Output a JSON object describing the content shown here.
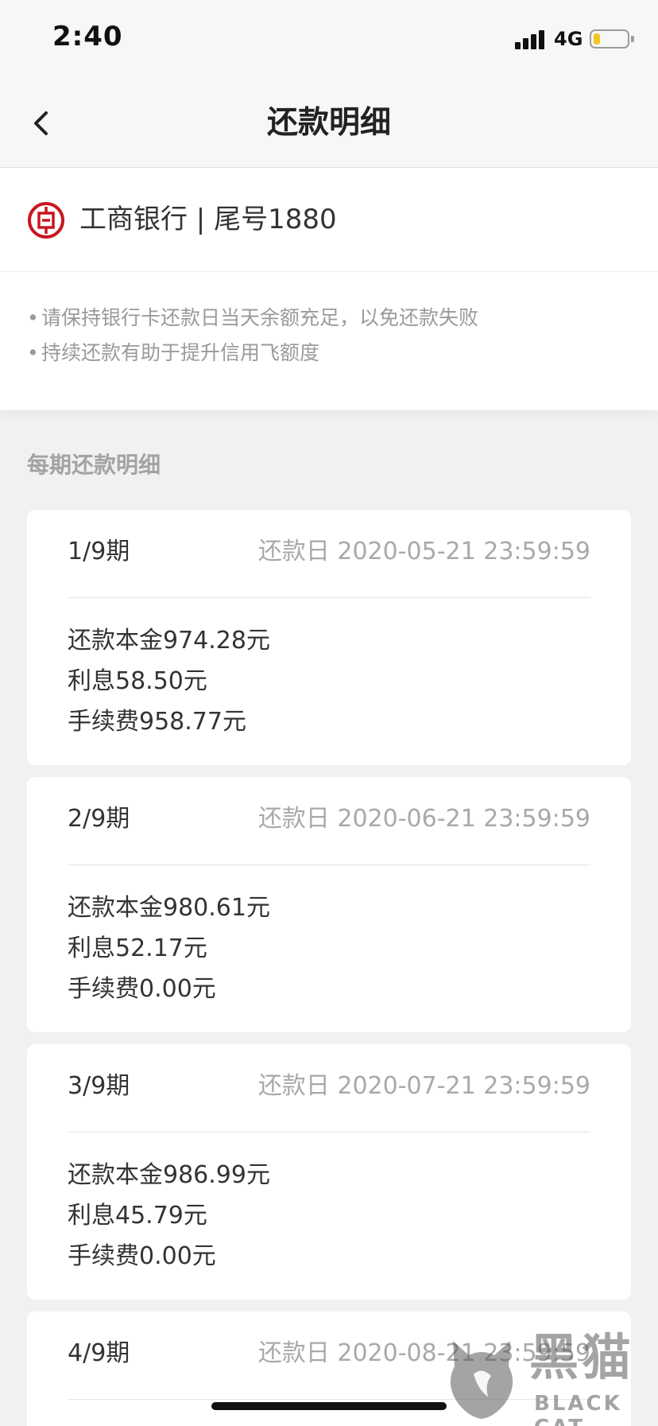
{
  "status_bar": {
    "time": "2:40",
    "network": "4G",
    "signal_icon": "signal-bars-icon",
    "battery_icon": "battery-low-icon",
    "battery_level": 0.2,
    "battery_color": "#f3c623"
  },
  "nav": {
    "title": "还款明细",
    "back_icon": "chevron-left-icon"
  },
  "bank": {
    "logo_icon": "icbc-logo-icon",
    "logo_color": "#c9151e",
    "name": "工商银行 | 尾号1880"
  },
  "tips": [
    "请保持银行卡还款日当天余额充足，以免还款失败",
    "持续还款有助于提升信用飞额度"
  ],
  "section_label": "每期还款明细",
  "installments": [
    {
      "period": "1/9期",
      "due": "还款日 2020-05-21 23:59:59",
      "principal": "还款本金974.28元",
      "interest": "利息58.50元",
      "fee": "手续费958.77元"
    },
    {
      "period": "2/9期",
      "due": "还款日 2020-06-21 23:59:59",
      "principal": "还款本金980.61元",
      "interest": "利息52.17元",
      "fee": "手续费0.00元"
    },
    {
      "period": "3/9期",
      "due": "还款日 2020-07-21 23:59:59",
      "principal": "还款本金986.99元",
      "interest": "利息45.79元",
      "fee": "手续费0.00元"
    },
    {
      "period": "4/9期",
      "due": "还款日 2020-08-21 23:59:59"
    }
  ],
  "watermark": {
    "cn": "黑猫",
    "en": "BLACK CAT",
    "icon": "black-cat-logo-icon"
  }
}
